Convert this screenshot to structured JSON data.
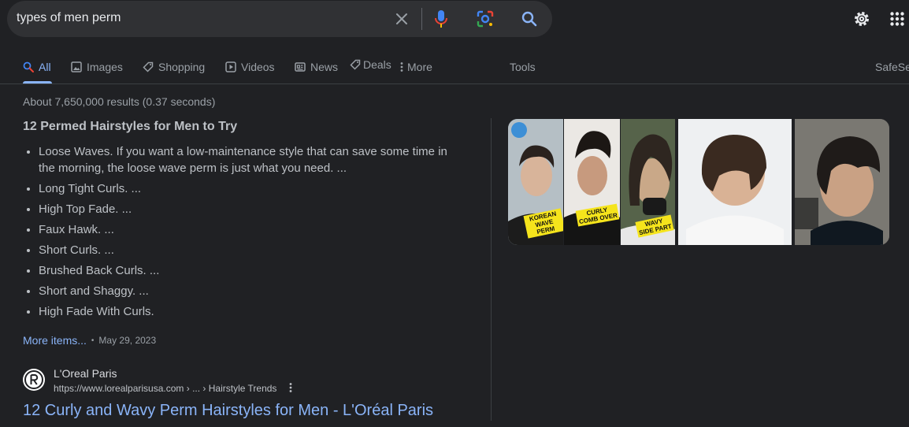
{
  "search": {
    "query": "types of men perm"
  },
  "tabs": [
    {
      "label": "All",
      "icon": "search-icon"
    },
    {
      "label": "Images",
      "icon": "image-icon"
    },
    {
      "label": "Shopping",
      "icon": "tag-icon"
    },
    {
      "label": "Videos",
      "icon": "play-icon"
    },
    {
      "label": "News",
      "icon": "news-icon"
    },
    {
      "label": "Deals",
      "icon": "tag-icon"
    },
    {
      "label": "More",
      "icon": "vertical-dots-icon"
    }
  ],
  "tools_label": "Tools",
  "safesearch_label": "SafeSe",
  "result_stats": "About 7,650,000 results (0.37 seconds)",
  "snippet": {
    "title": "12 Permed Hairstyles for Men to Try",
    "items": [
      "Loose Waves. If you want a low-maintenance style that can save some time in the morning, the loose wave perm is just what you need. ...",
      "Long Tight Curls. ...",
      "High Top Fade. ...",
      "Faux Hawk. ...",
      "Short Curls. ...",
      "Brushed Back Curls. ...",
      "Short and Shaggy. ...",
      "High Fade With Curls."
    ],
    "more_items_label": "More items...",
    "separator": "•",
    "date": "May 29, 2023"
  },
  "result": {
    "site_name": "L'Oreal Paris",
    "url": "https://www.lorealparisusa.com › ... › Hairstyle Trends",
    "title": "12 Curly and Wavy Perm Hairstyles for Men - L'Oréal Paris"
  },
  "images": [
    {
      "badges": [
        "KOREAN",
        "WAVE PERM"
      ]
    },
    {
      "badges": [
        "CURLY",
        "COMB OVER"
      ]
    },
    {
      "badges": [
        "WAVY",
        "SIDE PART"
      ]
    },
    {
      "badges": []
    },
    {
      "badges": []
    }
  ],
  "colors": {
    "background": "#202124",
    "link": "#8ab4f8",
    "text": "#bdc1c6",
    "badge": "#f5e41c"
  }
}
